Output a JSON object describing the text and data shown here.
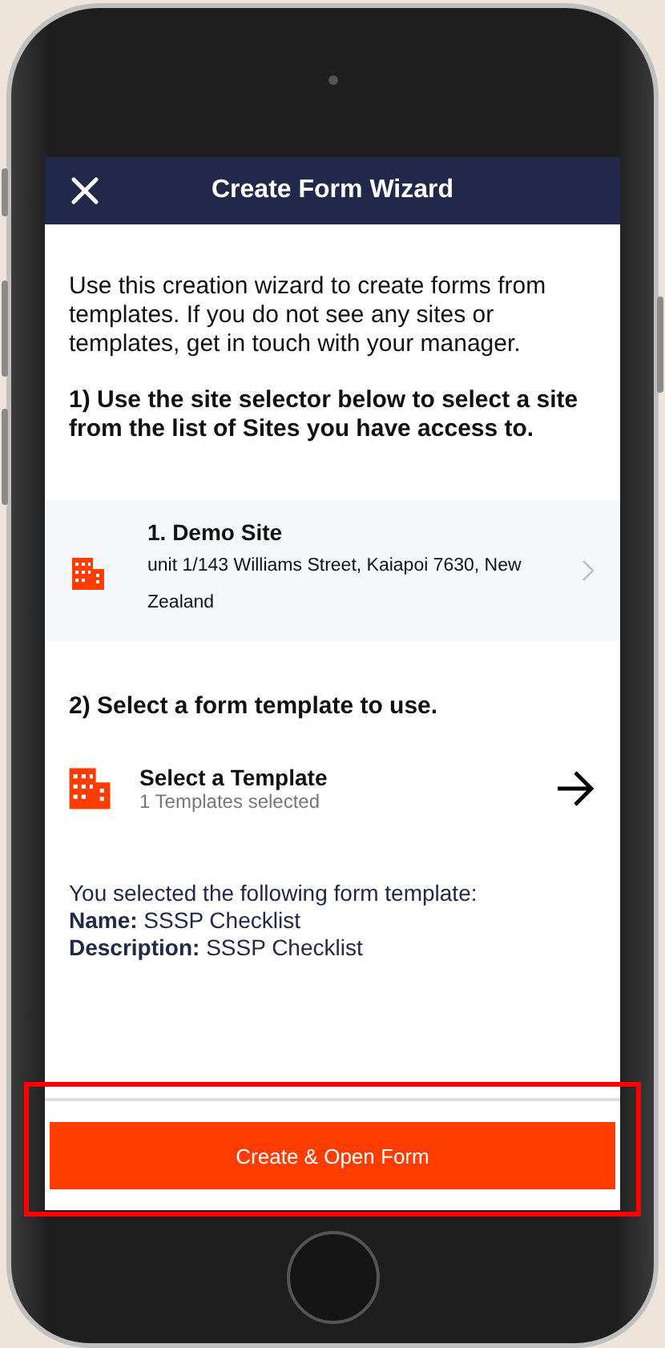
{
  "header": {
    "title": "Create Form Wizard"
  },
  "intro": "Use this creation wizard to create forms from templates. If you do not see any sites or templates, get in touch with your manager.",
  "step_1": "1) Use the site selector below to select a site from the list of Sites you have access to.",
  "site": {
    "name": "1. Demo Site",
    "address": "unit 1/143 Williams Street, Kaiapoi 7630, New Zealand"
  },
  "step_2": "2) Select a form template to use.",
  "template": {
    "title": "Select a Template",
    "subtitle": "1 Templates selected"
  },
  "selection": {
    "intro": "You selected the following form template:",
    "fields": [
      {
        "label": "Name:",
        "value": "SSSP Checklist"
      },
      {
        "label": "Description:",
        "value": "SSSP Checklist"
      }
    ]
  },
  "primary_button": "Create & Open Form"
}
